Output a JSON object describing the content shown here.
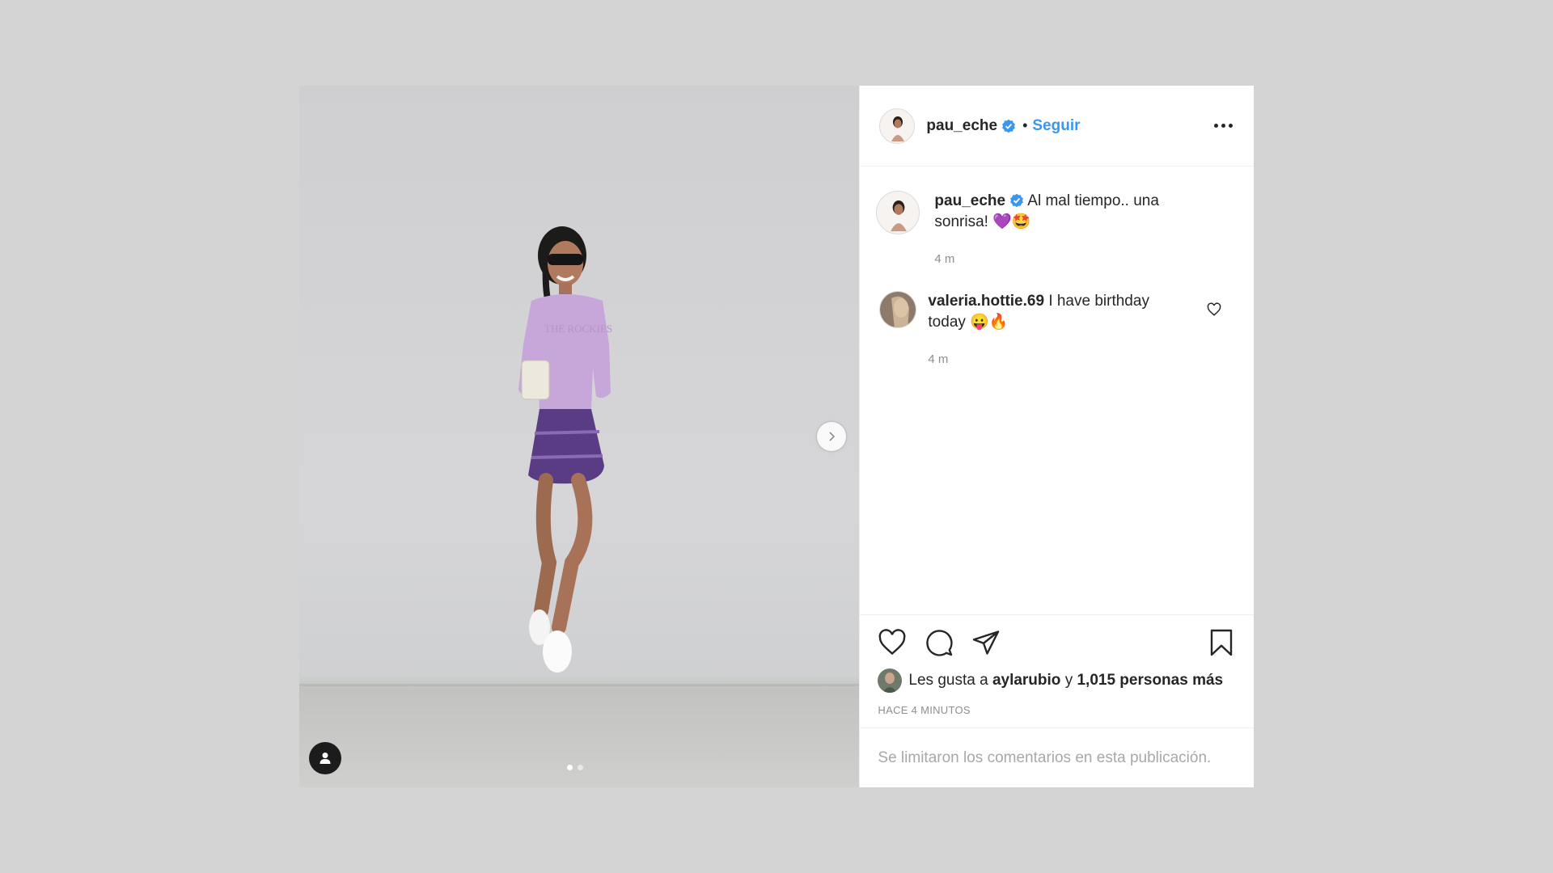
{
  "post": {
    "media": {
      "carousel": {
        "total": 2,
        "active_index": 0
      },
      "next_icon": "chevron-right-icon",
      "tag_icon": "person-tag-icon"
    },
    "header": {
      "username": "pau_eche",
      "verified": true,
      "separator": "•",
      "follow_label": "Seguir",
      "more_icon": "more-options-icon"
    },
    "comments": [
      {
        "username": "pau_eche",
        "verified": true,
        "text": "Al mal tiempo.. una sonrisa! 💜🤩",
        "time": "4 m",
        "is_caption": true
      },
      {
        "username": "valeria.hottie.69",
        "verified": false,
        "text": "I have birthday today 😛🔥",
        "time": "4 m",
        "is_caption": false
      }
    ],
    "actions": {
      "like_icon": "heart-icon",
      "comment_icon": "comment-icon",
      "share_icon": "paper-plane-icon",
      "save_icon": "bookmark-icon"
    },
    "likes": {
      "prefix": "Les gusta a",
      "user": "aylarubio",
      "connector": "y",
      "others": "1,015 personas más"
    },
    "timestamp": "HACE 4 MINUTOS",
    "comments_limited_notice": "Se limitaron los comentarios en esta publicación.",
    "colors": {
      "follow_blue": "#3897f0",
      "verified_blue": "#3897f0",
      "text_dark": "#262626",
      "text_muted": "#8e8e8e",
      "backdrop": "#d4d4d4"
    }
  }
}
